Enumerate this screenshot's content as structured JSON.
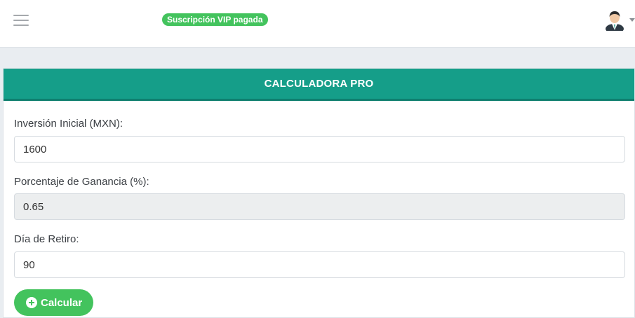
{
  "header": {
    "menu_icon": "hamburger-menu-icon",
    "vip_badge": "Suscripción VIP pagada",
    "avatar_icon": "user-avatar-icon",
    "dropdown_icon": "caret-down-icon"
  },
  "card": {
    "title": "CALCULADORA PRO",
    "fields": [
      {
        "label": "Inversión Inicial (MXN):",
        "value": "1600"
      },
      {
        "label": "Porcentaje de Ganancia (%):",
        "value": "0.65"
      },
      {
        "label": "Día de Retiro:",
        "value": "90"
      }
    ],
    "button": {
      "label": "Calcular",
      "icon": "plus-circle-icon"
    }
  },
  "colors": {
    "accent": "#159e89",
    "success": "#43c35d"
  }
}
